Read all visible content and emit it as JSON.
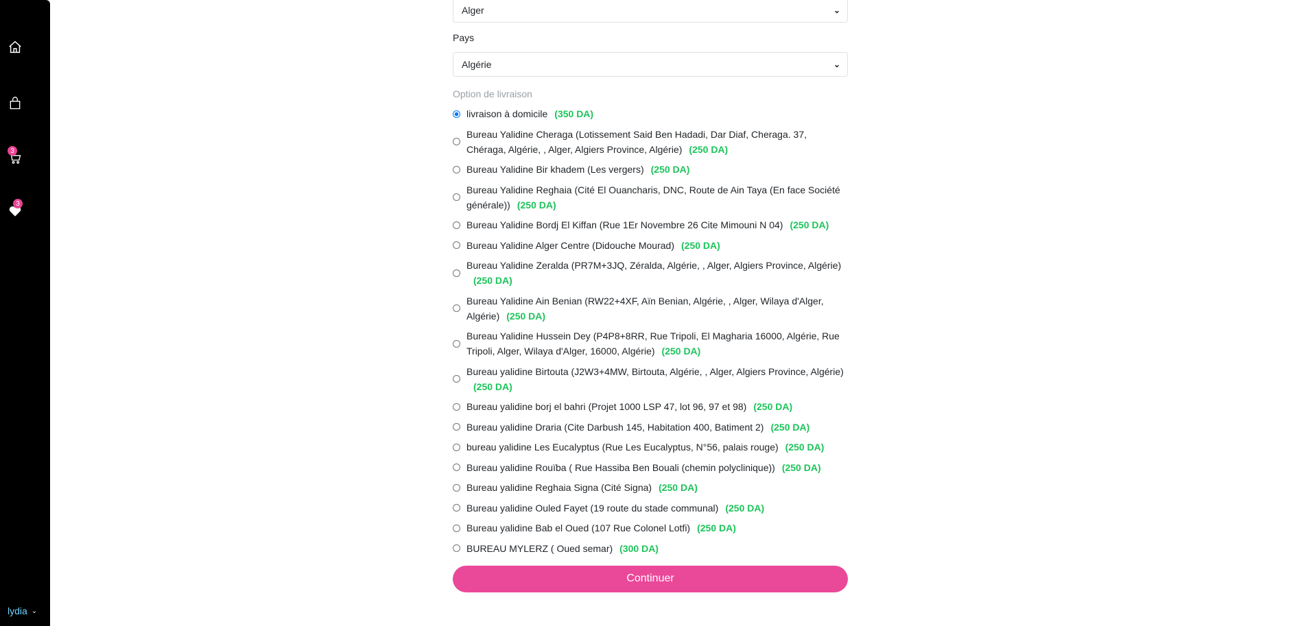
{
  "sidebar": {
    "cart_count": "3",
    "wishlist_count": "3",
    "user_name": "lydia"
  },
  "form": {
    "wilaya_value": "Alger",
    "country_label": "Pays",
    "country_value": "Algérie",
    "delivery_label": "Option de livraison",
    "options": [
      {
        "label": "livraison à domicile",
        "price": "(350 DA)",
        "selected": true
      },
      {
        "label": "Bureau Yalidine Cheraga (Lotissement Said Ben Hadadi, Dar Diaf, Cheraga. 37, Chéraga, Algérie, , Alger, Algiers Province, Algérie)",
        "price": "(250 DA)"
      },
      {
        "label": "Bureau Yalidine Bir khadem (Les vergers)",
        "price": "(250 DA)"
      },
      {
        "label": "Bureau Yalidine Reghaia (Cité El Ouancharis, DNC, Route de Ain Taya (En face Société générale))",
        "price": "(250 DA)"
      },
      {
        "label": "Bureau Yalidine Bordj El Kiffan (Rue 1Er Novembre 26 Cite Mimouni N 04)",
        "price": "(250 DA)"
      },
      {
        "label": "Bureau Yalidine Alger Centre (Didouche Mourad)",
        "price": "(250 DA)"
      },
      {
        "label": "Bureau Yalidine Zeralda (PR7M+3JQ, Zéralda, Algérie, , Alger, Algiers Province, Algérie)",
        "price": "(250 DA)"
      },
      {
        "label": "Bureau Yalidine Ain Benian (RW22+4XF, Aïn Benian, Algérie, , Alger, Wilaya d'Alger, Algérie)",
        "price": "(250 DA)"
      },
      {
        "label": "Bureau Yalidine Hussein Dey (P4P8+8RR, Rue Tripoli, El Magharia 16000, Algérie, Rue Tripoli, Alger, Wilaya d'Alger, 16000, Algérie)",
        "price": "(250 DA)"
      },
      {
        "label": "Bureau yalidine Birtouta (J2W3+4MW, Birtouta, Algérie, , Alger, Algiers Province, Algérie)",
        "price": "(250 DA)"
      },
      {
        "label": "Bureau yalidine borj el bahri (Projet 1000 LSP 47, lot 96, 97 et 98)",
        "price": "(250 DA)"
      },
      {
        "label": "Bureau yalidine Draria (Cite Darbush 145, Habitation 400, Batiment 2)",
        "price": "(250 DA)"
      },
      {
        "label": "bureau yalidine Les Eucalyptus (Rue Les Eucalyptus, N°56, palais rouge)",
        "price": "(250 DA)"
      },
      {
        "label": "Bureau yalidine Rouïba ( Rue Hassiba Ben Bouali (chemin polyclinique))",
        "price": "(250 DA)"
      },
      {
        "label": "Bureau yalidine Reghaia Signa (Cité Signa)",
        "price": "(250 DA)"
      },
      {
        "label": "Bureau yalidine Ouled Fayet (19 route du stade communal)",
        "price": "(250 DA)"
      },
      {
        "label": "Bureau yalidine Bab el Oued (107 Rue Colonel Lotfi)",
        "price": "(250 DA)"
      },
      {
        "label": "BUREAU MYLERZ ( Oued semar)",
        "price": "(300 DA)"
      }
    ],
    "continue_label": "Continuer"
  },
  "colors": {
    "accent": "#ea4899",
    "price": "#1cc45a",
    "sidebar": "#000000"
  }
}
